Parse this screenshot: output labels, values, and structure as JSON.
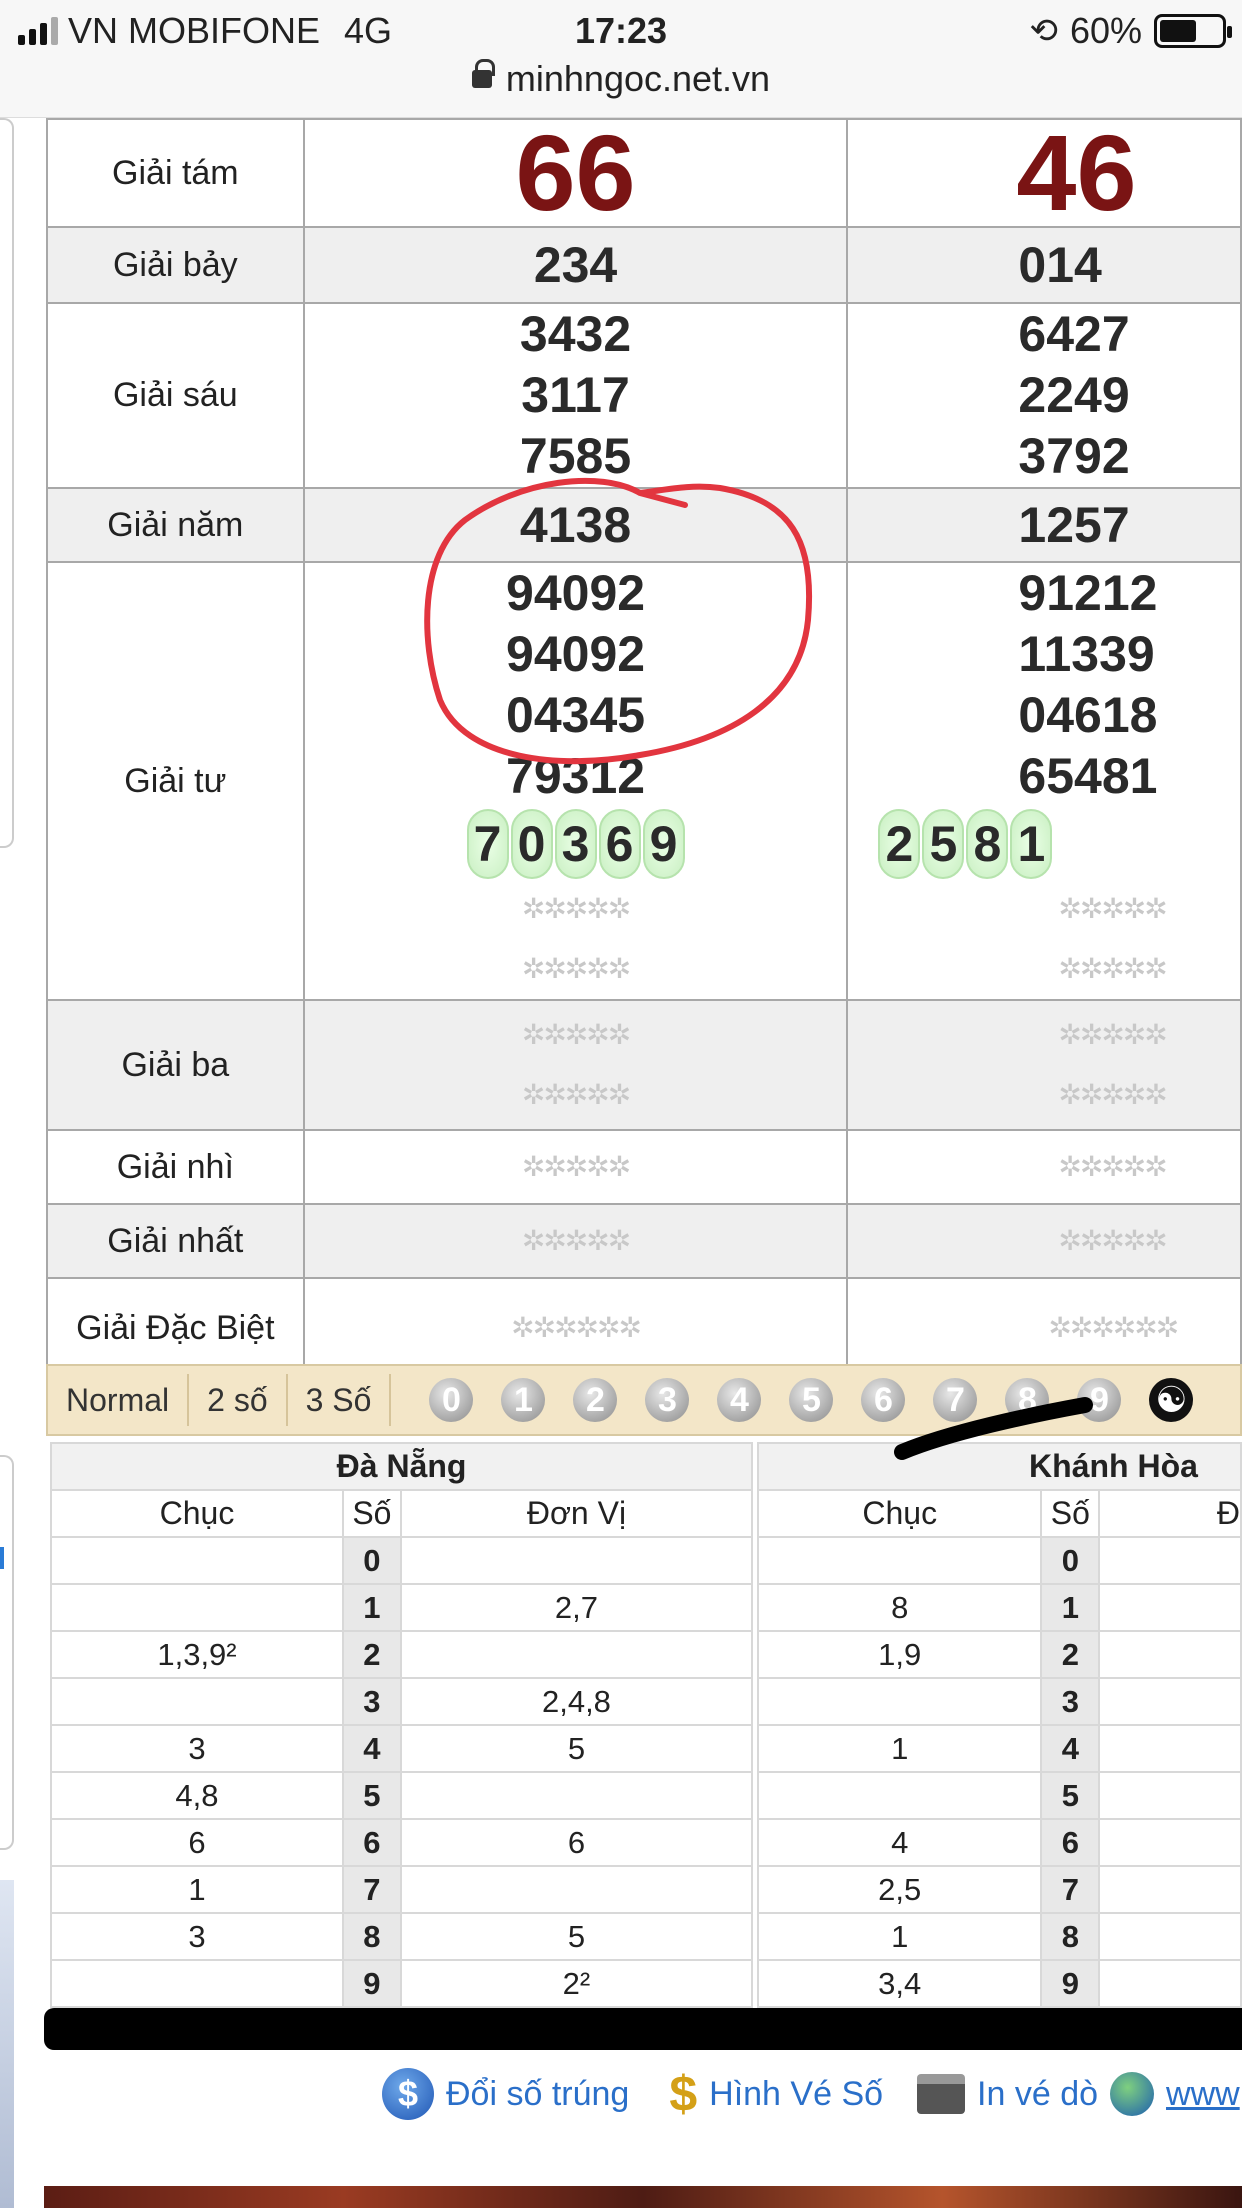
{
  "status_bar": {
    "carrier": "VN MOBIFONE",
    "network": "4G",
    "time": "17:23",
    "battery": "60%",
    "battery_level": 0.6
  },
  "url": "minhngoc.net.vn",
  "prizes": {
    "giai_tam": {
      "label": "Giải tám",
      "c1": "66",
      "c2": "46"
    },
    "giai_bay": {
      "label": "Giải bảy",
      "c1": "234",
      "c2": "014"
    },
    "giai_sau": {
      "label": "Giải sáu",
      "c1": [
        "3432",
        "3117",
        "7585"
      ],
      "c2": [
        "6427",
        "2249",
        "3792"
      ]
    },
    "giai_nam": {
      "label": "Giải năm",
      "c1": "4138",
      "c2": "1257"
    },
    "giai_tu": {
      "label": "Giải tư",
      "c1": [
        "94092",
        "94092",
        "04345",
        "79312"
      ],
      "c1_ball": "70369",
      "c2": [
        "91212",
        "11339",
        "04618",
        "65481"
      ],
      "c2_ball": "2581"
    },
    "giai_ba": {
      "label": "Giải ba"
    },
    "giai_nhi": {
      "label": "Giải nhì"
    },
    "giai_nhat": {
      "label": "Giải nhất"
    },
    "giai_dac_biet": {
      "label": "Giải Đặc Biệt"
    },
    "pending_5": "✲✲✲✲✲",
    "pending_6": "✲✲✲✲✲✲"
  },
  "filter": {
    "normal": "Normal",
    "two": "2 số",
    "three": "3 Số",
    "digits": [
      "0",
      "1",
      "2",
      "3",
      "4",
      "5",
      "6",
      "7",
      "8",
      "9"
    ]
  },
  "loto": {
    "left": {
      "province": "Đà Nẵng",
      "h_chuc": "Chục",
      "h_so": "Số",
      "h_donvi": "Đơn Vị"
    },
    "right": {
      "province": "Khánh Hòa",
      "h_chuc": "Chục",
      "h_so": "Số"
    },
    "rows": [
      {
        "lc": "",
        "ls": "0",
        "ld": "",
        "rc": "",
        "rs": "0"
      },
      {
        "lc": "",
        "ls": "1",
        "ld": "2,7",
        "rc": "8",
        "rs": "1"
      },
      {
        "lc": "1,3,9²",
        "ls": "2",
        "ld": "",
        "rc": "1,9",
        "rs": "2"
      },
      {
        "lc": "",
        "ls": "3",
        "ld": "2,4,8",
        "rc": "",
        "rs": "3"
      },
      {
        "lc": "3",
        "ls": "4",
        "ld": "5",
        "rc": "1",
        "rs": "4"
      },
      {
        "lc": "4,8",
        "ls": "5",
        "ld": "",
        "rc": "",
        "rs": "5"
      },
      {
        "lc": "6",
        "ls": "6",
        "ld": "6",
        "rc": "4",
        "rs": "6"
      },
      {
        "lc": "1",
        "ls": "7",
        "ld": "",
        "rc": "2,5",
        "rs": "7"
      },
      {
        "lc": "3",
        "ls": "8",
        "ld": "5",
        "rc": "1",
        "rs": "8"
      },
      {
        "lc": "",
        "ls": "9",
        "ld": "2²",
        "rc": "3,4",
        "rs": "9"
      }
    ]
  },
  "footer_links": {
    "doi_so": "Đổi số trúng",
    "hinh_ve": "Hình Vé Số",
    "in_ve": "In vé dò",
    "www": "www"
  }
}
